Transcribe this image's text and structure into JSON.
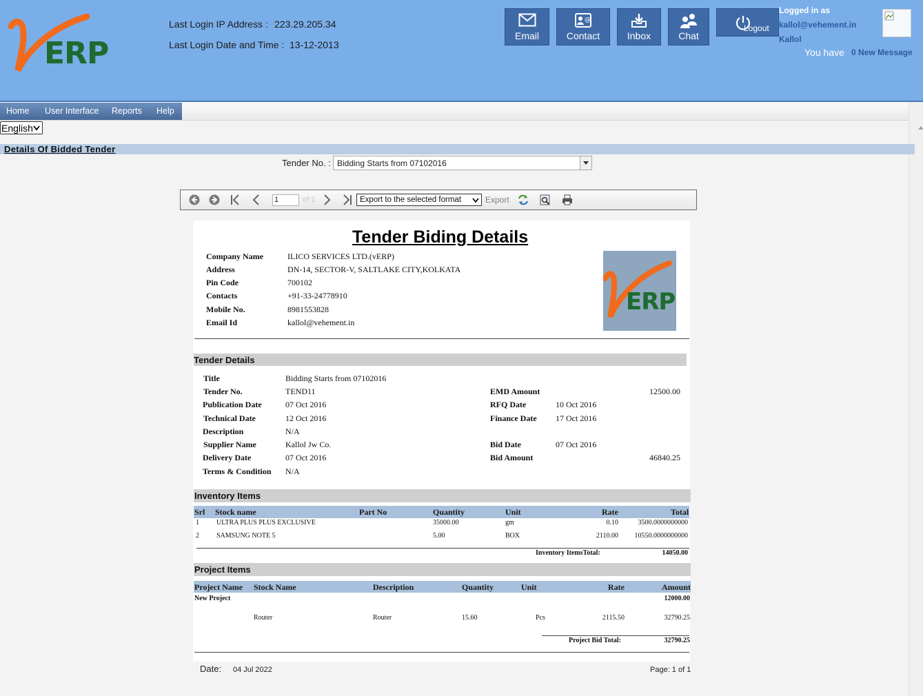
{
  "header": {
    "logo_text": "ERP",
    "login_ip_label": "Last Login IP Address :",
    "login_ip": "223.29.205.34",
    "login_date_label": "Last Login Date and Time :",
    "login_date": "13-12-2013",
    "buttons": {
      "email": "Email",
      "contact": "Contact",
      "inbox": "Inbox",
      "chat": "Chat",
      "logout": "Logout"
    },
    "logged_in_as": "Logged in as",
    "user_email": "kallol@vehement.in",
    "user_name": "Kallol",
    "you_have": "You have",
    "new_message": "0 New Message"
  },
  "menu": {
    "items": [
      "Home",
      "User Interface",
      "Reports",
      "Help"
    ]
  },
  "language": "English",
  "page": {
    "section_title": "Details Of Bidded Tender",
    "tender_label": "Tender No. :",
    "tender_select": "Bidding Starts from 07102016"
  },
  "viewer": {
    "page_input": "1",
    "page_of": "of 1",
    "export_select": "Export to the selected format",
    "export_label": "Export"
  },
  "report": {
    "title": "Tender Biding Details",
    "company": {
      "labels": [
        "Company Name",
        "Address",
        "Pin Code",
        "Contacts",
        "Mobile No.",
        "Email Id"
      ],
      "values": [
        "ILICO SERVICES LTD.(vERP)",
        "DN-14, SECTOR-V, SALTLAKE CITY,KOLKATA",
        "700102",
        "+91-33-24778910",
        "8981553828",
        "kallol@vehement.in"
      ]
    },
    "tender_details": {
      "heading": "Tender Details",
      "left_labels": [
        "Title",
        "Tender No.",
        "Publication Date",
        "Technical Date",
        "Description",
        "Supplier Name",
        "Delivery Date",
        "Terms & Condition"
      ],
      "left_values": [
        "Bidding Starts from 07102016",
        "TEND11",
        "07 Oct 2016",
        "12 Oct 2016",
        "N/A",
        "Kallol Jw Co.",
        "07 Oct 2016",
        "N/A"
      ],
      "emd_label": "EMD Amount",
      "emd_value": "12500.00",
      "rfq_label": "RFQ Date",
      "rfq_value": "10 Oct 2016",
      "finance_label": "Finance Date",
      "finance_value": "17 Oct 2016",
      "bid_date_label": "Bid Date",
      "bid_date_value": "07 Oct 2016",
      "bid_amount_label": "Bid Amount",
      "bid_amount_value": "46840.25"
    },
    "inventory": {
      "heading": "Inventory Items",
      "columns": [
        "Srl",
        "Stock name",
        "Part No",
        "Quantity",
        "Unit",
        "Rate",
        "Total"
      ],
      "rows": [
        [
          "1",
          "ULTRA PLUS PLUS EXCLUSIVE",
          "",
          "35000.00",
          "gm",
          "0.10",
          "3500.0000000000"
        ],
        [
          "2",
          "SAMSUNG NOTE 5",
          "",
          "5.00",
          "BOX",
          "2110.00",
          "10550.0000000000"
        ]
      ],
      "total_label": "Inventory ItemsTotal:",
      "total_value": "14050.00"
    },
    "project": {
      "heading": "Project Items",
      "columns": [
        "Project Name",
        "Stock Name",
        "Description",
        "Quantity",
        "Unit",
        "Rate",
        "Amount"
      ],
      "group_name": "New Project",
      "group_amount": "12000.00",
      "row": [
        "",
        "Router",
        "Router",
        "15.60",
        "Pcs",
        "2115.50",
        "32790.25"
      ],
      "total_label": "Project Bid Total:",
      "total_value": "32790.25"
    },
    "footer": {
      "date_label": "Date:",
      "date_value": "04 Jul 2022",
      "page_label": "Page: 1 of 1"
    }
  },
  "colors": {
    "header_bg": "#7aaee9",
    "button_bg": "#3f6aa8",
    "logo_orange": "#f26a1b",
    "logo_green": "#1e6b2f",
    "section_bar": "#b8cde4"
  }
}
